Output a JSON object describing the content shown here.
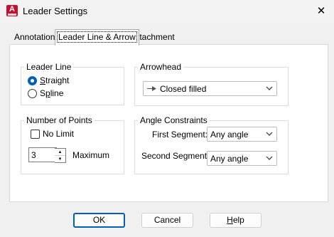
{
  "window": {
    "title": "Leader Settings",
    "app_icon_letter": "A",
    "close_glyph": "✕"
  },
  "tabs": [
    {
      "label": "Annotation",
      "active": false
    },
    {
      "label": "Leader Line & Arrow",
      "active": true
    },
    {
      "label": "Attachment",
      "active": false
    }
  ],
  "leader_line": {
    "title": "Leader Line",
    "straight": {
      "label_u": "S",
      "label_rest": "traight",
      "checked": true
    },
    "spline": {
      "label_pre": "S",
      "label_u": "p",
      "label_rest": "line",
      "checked": false
    }
  },
  "points": {
    "title": "Number of Points",
    "no_limit_label": "No Limit",
    "no_limit_checked": false,
    "value": "3",
    "maximum_label": "Maximum"
  },
  "arrowhead": {
    "title": "Arrowhead",
    "selected": "Closed filled",
    "icon": "closed-filled-arrow-icon"
  },
  "angles": {
    "title": "Angle Constraints",
    "first_label": "First Segment:",
    "first_value": "Any angle",
    "second_label": "Second Segment:",
    "second_value": "Any angle"
  },
  "buttons": {
    "ok": "OK",
    "cancel": "Cancel",
    "help_u": "H",
    "help_rest": "elp"
  },
  "colors": {
    "accent": "#005fb8",
    "app_icon": "#c8102e"
  }
}
